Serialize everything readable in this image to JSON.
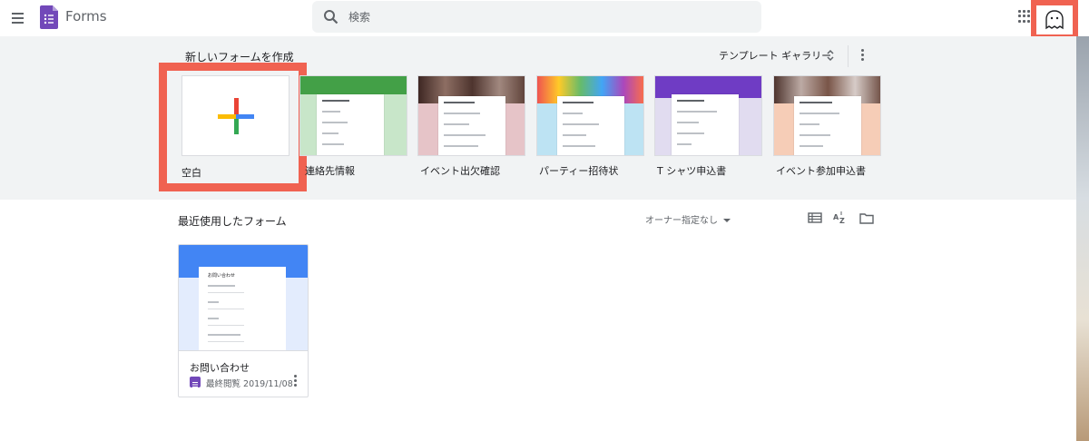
{
  "header": {
    "app_name": "Forms",
    "search_placeholder": "検索",
    "brand_color": "#7248b9",
    "highlight_color": "#f06251"
  },
  "templates": {
    "title": "新しいフォームを作成",
    "gallery_label": "テンプレート ギャラリー",
    "items": [
      {
        "label": "空白",
        "icon": "plus-icon"
      },
      {
        "label": "連絡先情報",
        "theme": "#c8e6c9",
        "band": "#43a047"
      },
      {
        "label": "イベント出欠確認",
        "theme": "#e6c4c8",
        "band": "#5d4037"
      },
      {
        "label": "パーティー招待状",
        "theme": "#bde3f3",
        "band": "#ffcc80"
      },
      {
        "label": "T シャツ申込書",
        "theme": "#e1dcf0",
        "band": "#6f3cc4"
      },
      {
        "label": "イベント参加申込書",
        "theme": "#f6cdb7",
        "band": "#6d4c41"
      }
    ]
  },
  "recent": {
    "title": "最近使用したフォーム",
    "owner_filter": "オーナー指定なし",
    "view_icons": [
      "list-view-icon",
      "sort-az-icon",
      "folder-icon"
    ],
    "files": [
      {
        "title": "お問い合わせ",
        "meta": "最終閲覧 2019/11/08",
        "thumb_title": "お問い合わせ"
      }
    ]
  }
}
